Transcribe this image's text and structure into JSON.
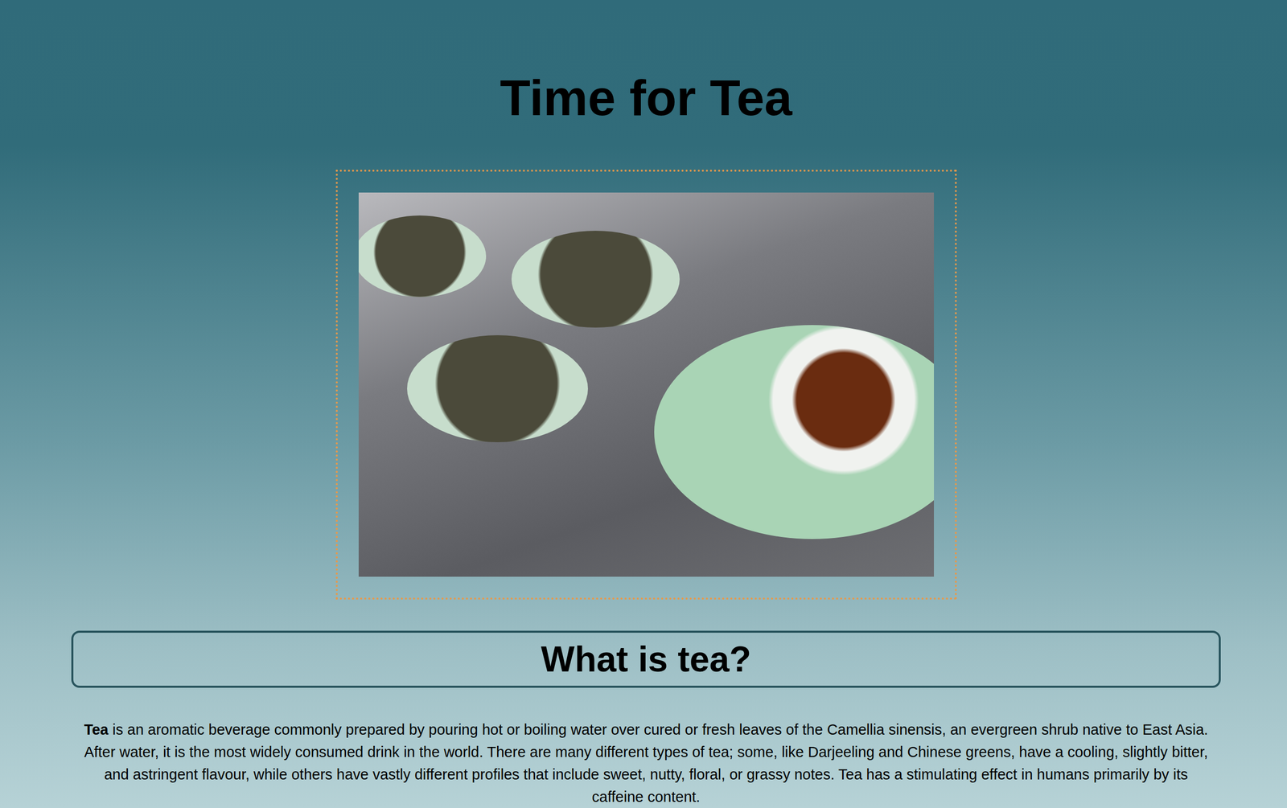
{
  "page": {
    "title": "Time for Tea"
  },
  "photo": {
    "caption_shown": false
  },
  "section": {
    "heading": "What is tea?",
    "paragraph": [
      {
        "text": "Tea",
        "bold": true
      },
      {
        "text": " is an aromatic beverage commonly prepared by pouring hot or boiling water over cured or fresh leaves of the Camellia sinensis, an evergreen shrub native to East Asia. After water, it is the most widely consumed drink in the world. There are many different types of tea; some, like Darjeeling and Chinese greens, have a cooling, slightly bitter, and astringent flavour, while others have vastly different profiles that include sweet, nutty, floral, or grassy notes. Tea has a stimulating effect in humans primarily by its caffeine content.",
        "bold": false
      }
    ]
  }
}
